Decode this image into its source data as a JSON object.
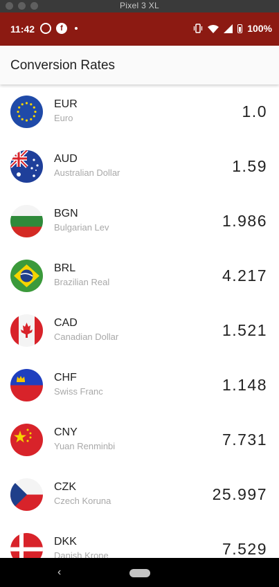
{
  "emulator": {
    "title": "Pixel 3 XL"
  },
  "status_bar": {
    "time": "11:42",
    "battery": "100%",
    "background": "#8c1a12",
    "left_icons": [
      "whatsapp-icon",
      "f-app-icon",
      "notification-dot-icon"
    ],
    "right_icons": [
      "vibrate-icon",
      "wifi-icon",
      "signal-icon",
      "battery-icon"
    ]
  },
  "app_bar": {
    "title": "Conversion Rates"
  },
  "currencies": [
    {
      "code": "EUR",
      "name": "Euro",
      "rate": "1.0",
      "flag": "eu-flag-icon"
    },
    {
      "code": "AUD",
      "name": "Australian Dollar",
      "rate": "1.59",
      "flag": "au-flag-icon"
    },
    {
      "code": "BGN",
      "name": "Bulgarian Lev",
      "rate": "1.986",
      "flag": "bg-flag-icon"
    },
    {
      "code": "BRL",
      "name": "Brazilian Real",
      "rate": "4.217",
      "flag": "br-flag-icon"
    },
    {
      "code": "CAD",
      "name": "Canadian Dollar",
      "rate": "1.521",
      "flag": "ca-flag-icon"
    },
    {
      "code": "CHF",
      "name": "Swiss Franc",
      "rate": "1.148",
      "flag": "li-flag-icon"
    },
    {
      "code": "CNY",
      "name": "Yuan Renminbi",
      "rate": "7.731",
      "flag": "cn-flag-icon"
    },
    {
      "code": "CZK",
      "name": "Czech Koruna",
      "rate": "25.997",
      "flag": "cz-flag-icon"
    },
    {
      "code": "DKK",
      "name": "Danish Krone",
      "rate": "7.529",
      "flag": "dk-flag-icon"
    }
  ],
  "nav_bar": {
    "back_icon": "back-chevron-icon",
    "home_icon": "home-pill-icon"
  }
}
